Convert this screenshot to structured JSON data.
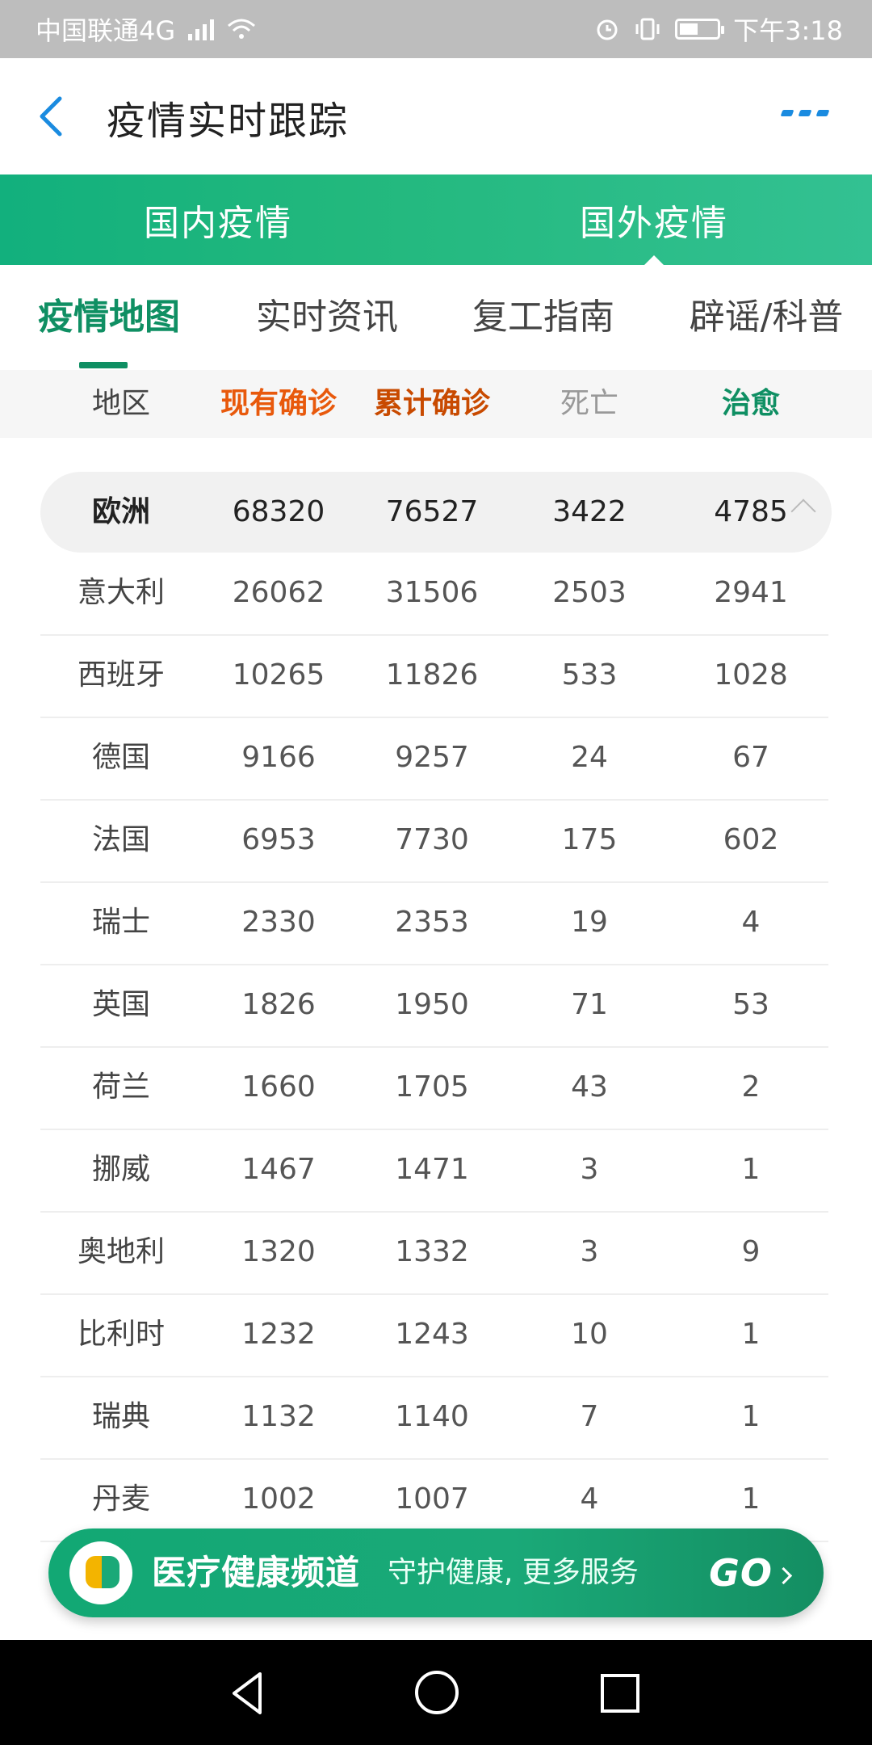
{
  "status_bar": {
    "carrier": "中国联通4G",
    "network_badge": "4G",
    "time": "下午3:18"
  },
  "header": {
    "title": "疫情实时跟踪"
  },
  "top_tabs": [
    {
      "label": "国内疫情",
      "active": false
    },
    {
      "label": "国外疫情",
      "active": true
    }
  ],
  "sub_tabs": [
    {
      "label": "疫情地图",
      "active": true
    },
    {
      "label": "实时资讯",
      "active": false
    },
    {
      "label": "复工指南",
      "active": false
    },
    {
      "label": "辟谣/科普",
      "active": false
    }
  ],
  "columns": [
    {
      "label": "地区",
      "color": "#444444"
    },
    {
      "label": "现有确诊",
      "color": "#e8590c"
    },
    {
      "label": "累计确诊",
      "color": "#c84a00"
    },
    {
      "label": "死亡",
      "color": "#999999"
    },
    {
      "label": "治愈",
      "color": "#0f8f63"
    }
  ],
  "group": {
    "region": "欧洲",
    "current": "68320",
    "total": "76527",
    "deaths": "3422",
    "cured": "4785"
  },
  "rows": [
    {
      "region": "意大利",
      "current": "26062",
      "total": "31506",
      "deaths": "2503",
      "cured": "2941"
    },
    {
      "region": "西班牙",
      "current": "10265",
      "total": "11826",
      "deaths": "533",
      "cured": "1028"
    },
    {
      "region": "德国",
      "current": "9166",
      "total": "9257",
      "deaths": "24",
      "cured": "67"
    },
    {
      "region": "法国",
      "current": "6953",
      "total": "7730",
      "deaths": "175",
      "cured": "602"
    },
    {
      "region": "瑞士",
      "current": "2330",
      "total": "2353",
      "deaths": "19",
      "cured": "4"
    },
    {
      "region": "英国",
      "current": "1826",
      "total": "1950",
      "deaths": "71",
      "cured": "53"
    },
    {
      "region": "荷兰",
      "current": "1660",
      "total": "1705",
      "deaths": "43",
      "cured": "2"
    },
    {
      "region": "挪威",
      "current": "1467",
      "total": "1471",
      "deaths": "3",
      "cured": "1"
    },
    {
      "region": "奥地利",
      "current": "1320",
      "total": "1332",
      "deaths": "3",
      "cured": "9"
    },
    {
      "region": "比利时",
      "current": "1232",
      "total": "1243",
      "deaths": "10",
      "cured": "1"
    },
    {
      "region": "瑞典",
      "current": "1132",
      "total": "1140",
      "deaths": "7",
      "cured": "1"
    },
    {
      "region": "丹麦",
      "current": "1002",
      "total": "1007",
      "deaths": "4",
      "cured": "1"
    }
  ],
  "banner": {
    "title": "医疗健康频道",
    "subtitle": "守护健康, 更多服务",
    "go": "GO"
  }
}
